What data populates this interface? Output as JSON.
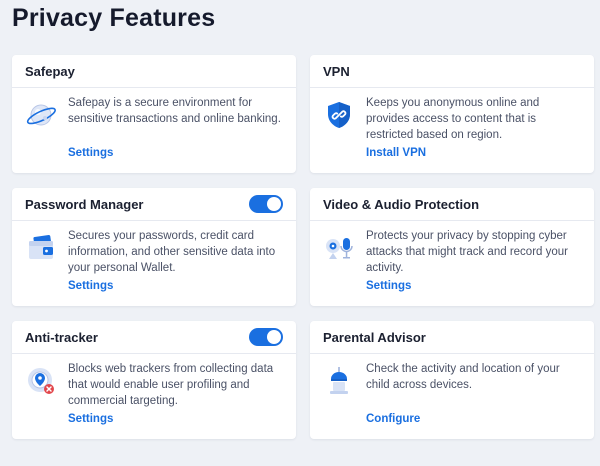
{
  "page": {
    "title": "Privacy Features"
  },
  "colors": {
    "accent": "#1a6fe0",
    "background": "#eef1f6",
    "card": "#ffffff"
  },
  "cards": [
    {
      "title": "Safepay",
      "icon": "globe-planet-icon",
      "description": "Safepay is a secure environment for sensitive transactions and online banking.",
      "link": "Settings"
    },
    {
      "title": "VPN",
      "icon": "shield-link-icon",
      "description": "Keeps you anonymous online and provides access to content that is restricted based on region.",
      "link": "Install VPN"
    },
    {
      "title": "Password Manager",
      "toggle": true,
      "icon": "wallet-icon",
      "description": "Secures your passwords, credit card information, and other sensitive data into your personal Wallet.",
      "link": "Settings"
    },
    {
      "title": "Video & Audio Protection",
      "icon": "webcam-microphone-icon",
      "description": "Protects your privacy by stopping cyber attacks that might track and record your activity.",
      "link": "Settings"
    },
    {
      "title": "Anti-tracker",
      "toggle": true,
      "icon": "tracker-block-icon",
      "description": "Blocks web trackers from collecting data that would enable user profiling and commercial targeting.",
      "link": "Settings"
    },
    {
      "title": "Parental Advisor",
      "icon": "child-lamp-icon",
      "description": "Check the activity and location of your child across devices.",
      "link": "Configure"
    }
  ]
}
